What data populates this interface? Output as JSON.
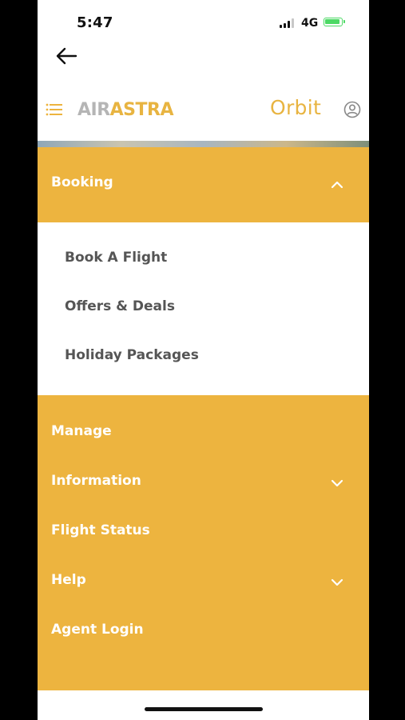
{
  "status_bar": {
    "time": "5:47",
    "network": "4G"
  },
  "header": {
    "logo_air": "AIR",
    "logo_astra": "ASTRA",
    "loyalty_brand": "Orbit"
  },
  "colors": {
    "accent": "#edb43f",
    "logo_grey": "#b5b5b5",
    "submenu_text": "#555555"
  },
  "menu": {
    "booking": {
      "label": "Booking",
      "expanded": true,
      "items": [
        "Book A Flight",
        "Offers & Deals",
        "Holiday Packages"
      ]
    },
    "sections": [
      {
        "label": "Manage",
        "has_dropdown": false
      },
      {
        "label": "Information",
        "has_dropdown": true
      },
      {
        "label": "Flight Status",
        "has_dropdown": false
      },
      {
        "label": "Help",
        "has_dropdown": true
      },
      {
        "label": "Agent Login",
        "has_dropdown": false
      }
    ]
  },
  "icons": [
    "back-arrow-icon",
    "hamburger-menu-icon",
    "user-profile-icon",
    "chevron-up-icon",
    "chevron-down-icon"
  ]
}
